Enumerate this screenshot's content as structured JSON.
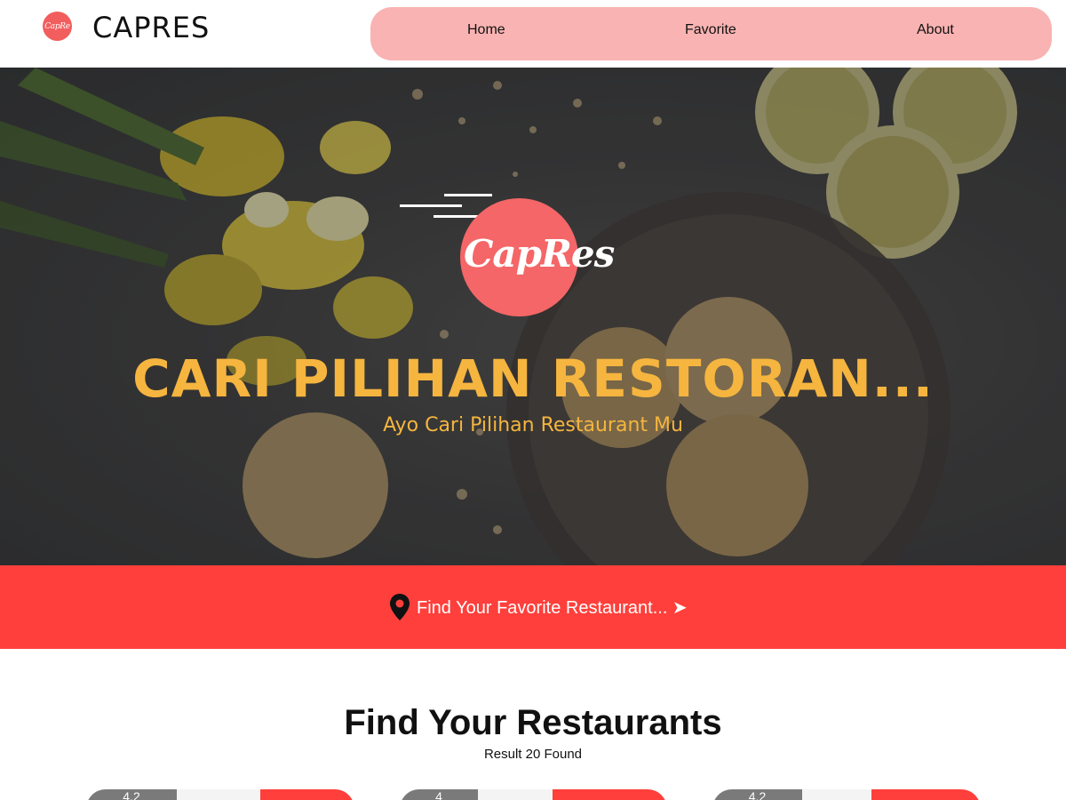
{
  "header": {
    "logo_text": "CapRe",
    "brand": "CAPRES",
    "nav": [
      "Home",
      "Favorite",
      "About"
    ]
  },
  "hero": {
    "logo_text": "CapRes",
    "title": "CARI PILIHAN RESTORAN...",
    "subtitle": "Ayo Cari Pilihan Restaurant Mu"
  },
  "search": {
    "label": "Find Your Favorite Restaurant... ➤"
  },
  "restaurants": {
    "title": "Find Your Restaurants",
    "result_text": "Result 20 Found",
    "cards": [
      {
        "rating": "4.2"
      },
      {
        "rating": "4"
      },
      {
        "rating": "4.2"
      }
    ]
  },
  "colors": {
    "accent": "#ff3f3b",
    "nav_bg": "#f9b3b2",
    "hero_text": "#f5b53f",
    "logo": "#f46667"
  },
  "icons": [
    "menu-icon",
    "location-pin-icon"
  ]
}
